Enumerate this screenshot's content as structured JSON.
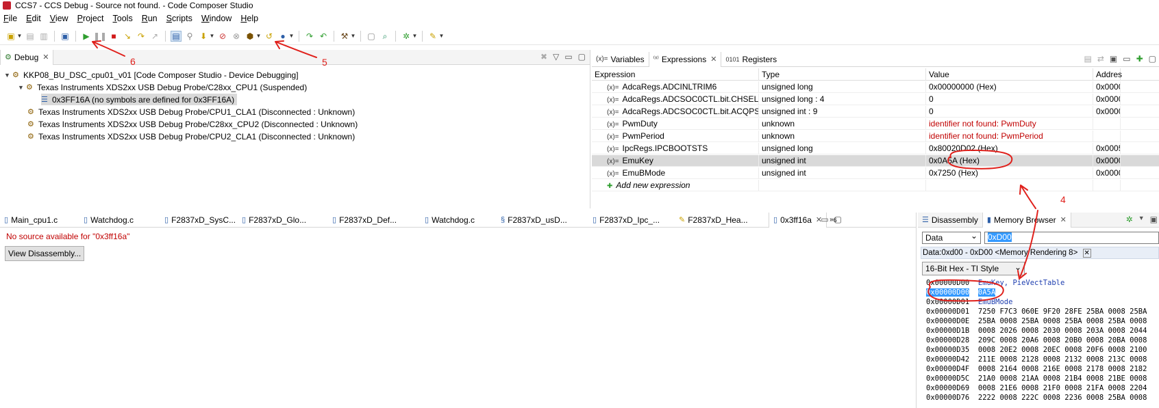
{
  "window": {
    "title": "CCS7 - CCS Debug - Source not found. - Code Composer Studio"
  },
  "menu": [
    "File",
    "Edit",
    "View",
    "Project",
    "Tools",
    "Run",
    "Scripts",
    "Window",
    "Help"
  ],
  "debug_view": {
    "tab": "Debug",
    "rows": [
      "KKP08_BU_DSC_cpu01_v01 [Code Composer Studio - Device Debugging]",
      "Texas Instruments XDS2xx USB Debug Probe/C28xx_CPU1 (Suspended)",
      "0x3FF16A  (no symbols are defined for 0x3FF16A)",
      "Texas Instruments XDS2xx USB Debug Probe/CPU1_CLA1 (Disconnected : Unknown)",
      "Texas Instruments XDS2xx USB Debug Probe/C28xx_CPU2 (Disconnected : Unknown)",
      "Texas Instruments XDS2xx USB Debug Probe/CPU2_CLA1 (Disconnected : Unknown)"
    ]
  },
  "expressions_view": {
    "tabs": [
      "Variables",
      "Expressions",
      "Registers"
    ],
    "columns": [
      "Expression",
      "Type",
      "Value",
      "Addres"
    ],
    "rows": [
      {
        "expr": "AdcaRegs.ADCINLTRIM6",
        "type": "unsigned long",
        "value": "0x00000000 (Hex)",
        "addr": "0x0000"
      },
      {
        "expr": "AdcaRegs.ADCSOC0CTL.bit.CHSEL",
        "type": "unsigned long : 4",
        "value": "0",
        "addr": "0x0000"
      },
      {
        "expr": "AdcaRegs.ADCSOC0CTL.bit.ACQPS",
        "type": "unsigned int : 9",
        "value": "0",
        "addr": "0x0000"
      },
      {
        "expr": "PwmDuty",
        "type": "unknown",
        "value": "identifier not found: PwmDuty",
        "addr": ""
      },
      {
        "expr": "PwmPeriod",
        "type": "unknown",
        "value": "identifier not found: PwmPeriod",
        "addr": ""
      },
      {
        "expr": "IpcRegs.IPCBOOTSTS",
        "type": "unsigned long",
        "value": "0x80020D02 (Hex)",
        "addr": "0x0005"
      },
      {
        "expr": "EmuKey",
        "type": "unsigned int",
        "value": "0x0A5A (Hex)",
        "addr": "0x0000"
      },
      {
        "expr": "EmuBMode",
        "type": "unsigned int",
        "value": "0x7250 (Hex)",
        "addr": "0x0000"
      }
    ],
    "add_label": "Add new expression"
  },
  "editor": {
    "tabs": [
      "Main_cpu1.c",
      "Watchdog.c",
      "F2837xD_SysC...",
      "F2837xD_Glo...",
      "F2837xD_Def...",
      "Watchdog.c",
      "F2837xD_usD...",
      "F2837xD_Ipc_...",
      "F2837xD_Hea...",
      "0x3ff16a"
    ],
    "overflow": "6",
    "message": "No source available for \"0x3ff16a\"",
    "button": "View Disassembly..."
  },
  "memory": {
    "tabs": [
      "Disassembly",
      "Memory Browser"
    ],
    "page": "Data",
    "address": "0xD00",
    "rendering_tab": "Data:0xd00 - 0xD00 <Memory Rendering 8>",
    "format": "16-Bit Hex - TI Style",
    "lines": [
      {
        "addr": "0x00000D00",
        "data": "",
        "sym": "EmuKey, PieVectTable"
      },
      {
        "addr": "0x00000D00",
        "data": "0A5A",
        "sym": "",
        "hl": true
      },
      {
        "addr": "0x00000D01",
        "data": "",
        "sym": "EmuBMode"
      },
      {
        "addr": "0x00000D01",
        "data": "7250 F7C3 060E 9F20 28FE 25BA 0008 25BA",
        "sym": ""
      },
      {
        "addr": "0x00000D0E",
        "data": "25BA 0008 25BA 0008 25BA 0008 25BA 0008",
        "sym": ""
      },
      {
        "addr": "0x00000D1B",
        "data": "0008 2026 0008 2030 0008 203A 0008 2044",
        "sym": ""
      },
      {
        "addr": "0x00000D28",
        "data": "209C 0008 20A6 0008 20B0 0008 20BA 0008",
        "sym": ""
      },
      {
        "addr": "0x00000D35",
        "data": "0008 20E2 0008 20EC 0008 20F6 0008 2100",
        "sym": ""
      },
      {
        "addr": "0x00000D42",
        "data": "211E 0008 2128 0008 2132 0008 213C 0008",
        "sym": ""
      },
      {
        "addr": "0x00000D4F",
        "data": "0008 2164 0008 216E 0008 2178 0008 2182",
        "sym": ""
      },
      {
        "addr": "0x00000D5C",
        "data": "21A0 0008 21AA 0008 21B4 0008 21BE 0008",
        "sym": ""
      },
      {
        "addr": "0x00000D69",
        "data": "0008 21E6 0008 21F0 0008 21FA 0008 2204",
        "sym": ""
      },
      {
        "addr": "0x00000D76",
        "data": "2222 0008 222C 0008 2236 0008 25BA 0008",
        "sym": ""
      }
    ]
  },
  "annotations": {
    "labels": [
      "6",
      "5",
      "4"
    ],
    "color": "#e0201b"
  }
}
